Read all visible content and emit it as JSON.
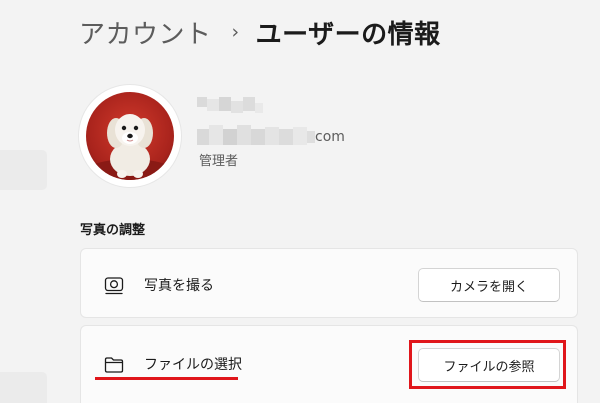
{
  "breadcrumb": {
    "parent": "アカウント",
    "separator": "›",
    "current": "ユーザーの情報"
  },
  "profile": {
    "email_suffix": "com",
    "role": "管理者"
  },
  "photo_section": {
    "title": "写真の調整",
    "take_photo": {
      "icon": "camera-icon",
      "label": "写真を撮る",
      "button": "カメラを開く"
    },
    "browse_file": {
      "icon": "folder-icon",
      "label": "ファイルの選択",
      "button": "ファイルの参照"
    }
  },
  "colors": {
    "accent_red": "#e0161b",
    "background": "#f3f3f3",
    "card": "#fbfbfb"
  }
}
